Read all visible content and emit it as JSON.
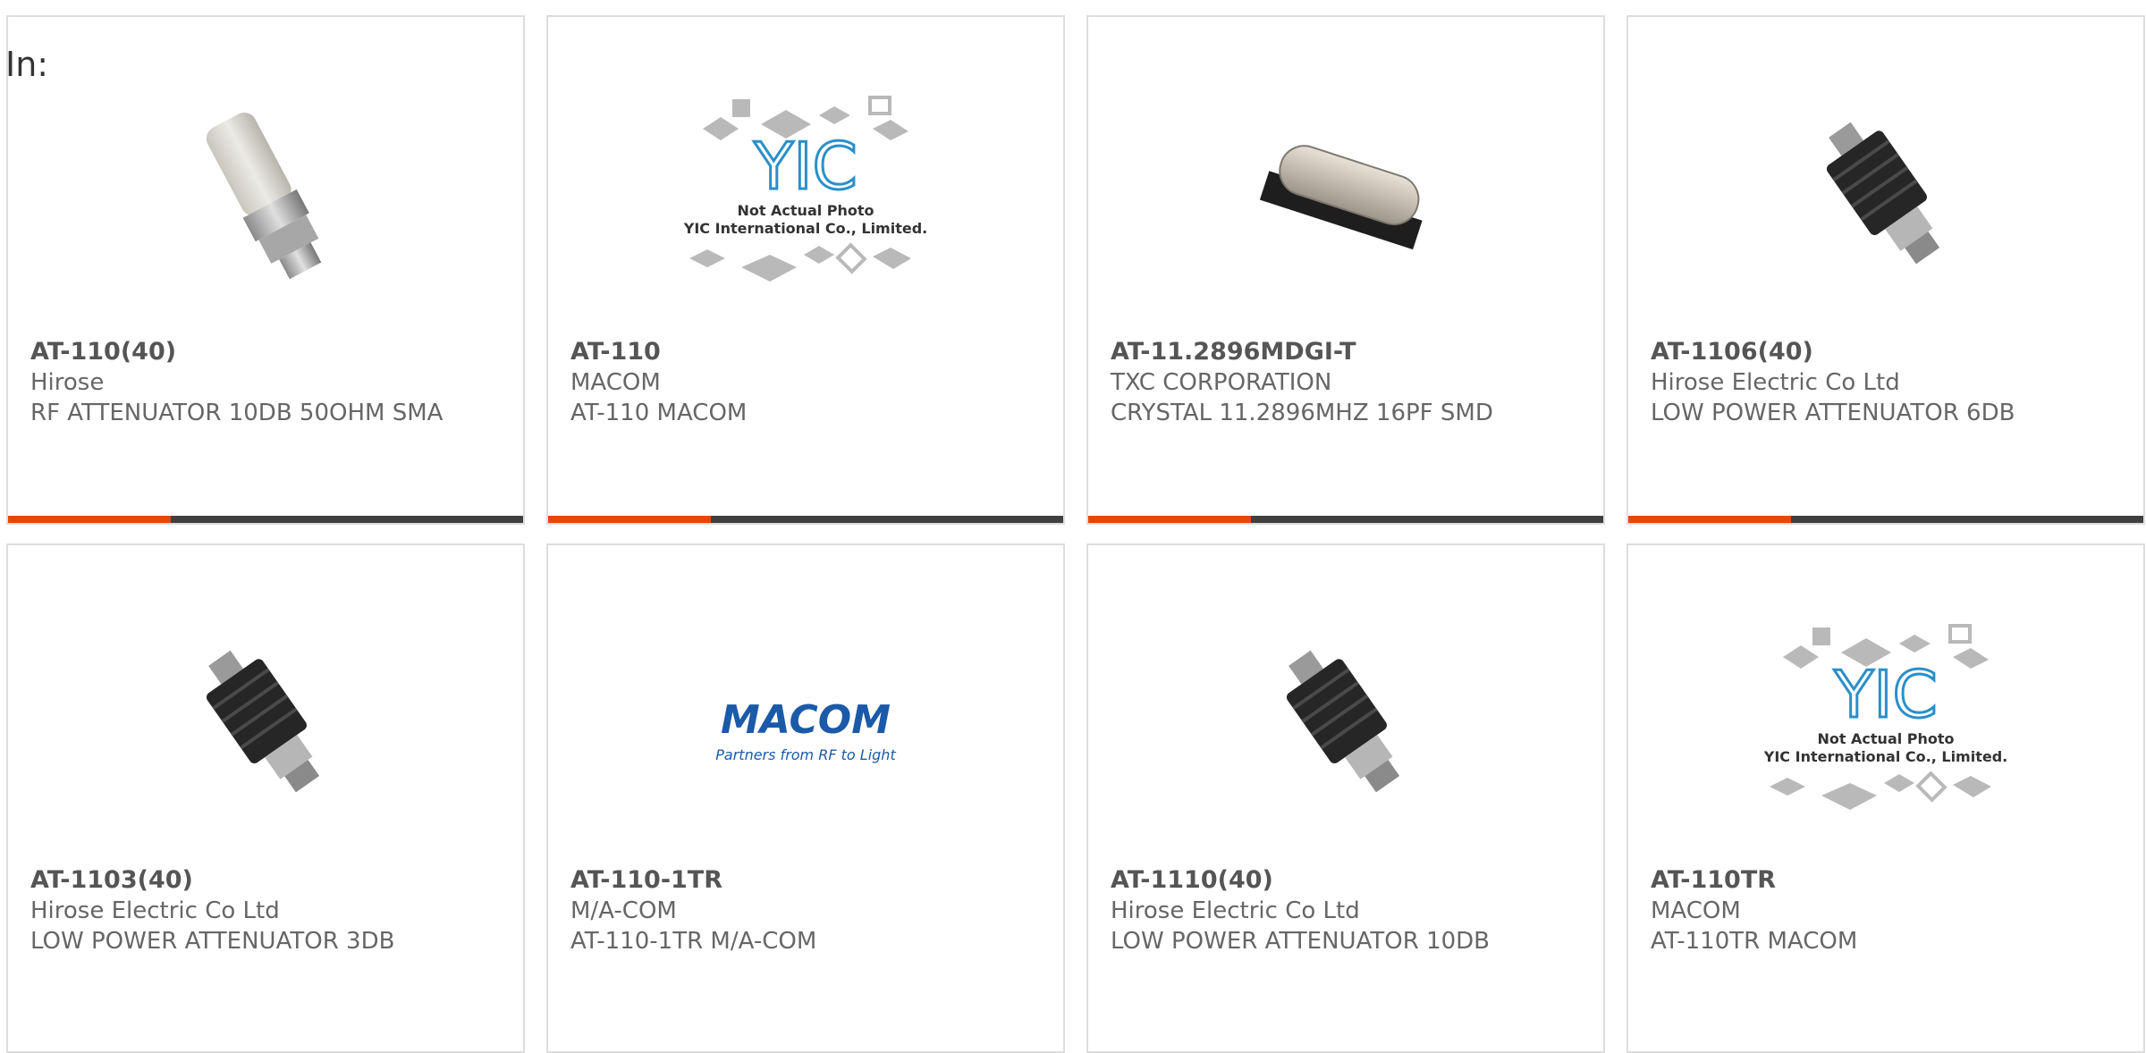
{
  "page": {
    "label": "In:"
  },
  "colors": {
    "accent": "#e8450c",
    "bar": "#404040",
    "border": "#dddddd",
    "text": "#666666"
  },
  "products": [
    {
      "part": "AT-110(40)",
      "maker": "Hirose",
      "desc": "RF ATTENUATOR 10DB 50OHM SMA",
      "image": "sma-attenuator-photo"
    },
    {
      "part": "AT-110",
      "maker": "MACOM",
      "desc": "AT-110 MACOM",
      "image": "yic-placeholder"
    },
    {
      "part": "AT-11.2896MDGI-T",
      "maker": "TXC CORPORATION",
      "desc": "CRYSTAL 11.2896MHZ 16PF SMD",
      "image": "crystal-photo"
    },
    {
      "part": "AT-1106(40)",
      "maker": "Hirose Electric Co Ltd",
      "desc": "LOW POWER ATTENUATOR 6DB",
      "image": "black-attenuator-photo"
    },
    {
      "part": "AT-1103(40)",
      "maker": "Hirose Electric Co Ltd",
      "desc": "LOW POWER ATTENUATOR 3DB",
      "image": "black-attenuator-photo"
    },
    {
      "part": "AT-110-1TR",
      "maker": "M/A-COM",
      "desc": "AT-110-1TR M/A-COM",
      "image": "macom-logo"
    },
    {
      "part": "AT-1110(40)",
      "maker": "Hirose Electric Co Ltd",
      "desc": "LOW POWER ATTENUATOR 10DB",
      "image": "black-attenuator-photo"
    },
    {
      "part": "AT-110TR",
      "maker": "MACOM",
      "desc": "AT-110TR MACOM",
      "image": "yic-placeholder"
    }
  ],
  "placeholder": {
    "line1": "Not Actual Photo",
    "line2": "YIC International Co., Limited.",
    "logo": "YIC"
  },
  "macom_logo": {
    "name": "MACOM",
    "tagline": "Partners from RF to Light"
  }
}
